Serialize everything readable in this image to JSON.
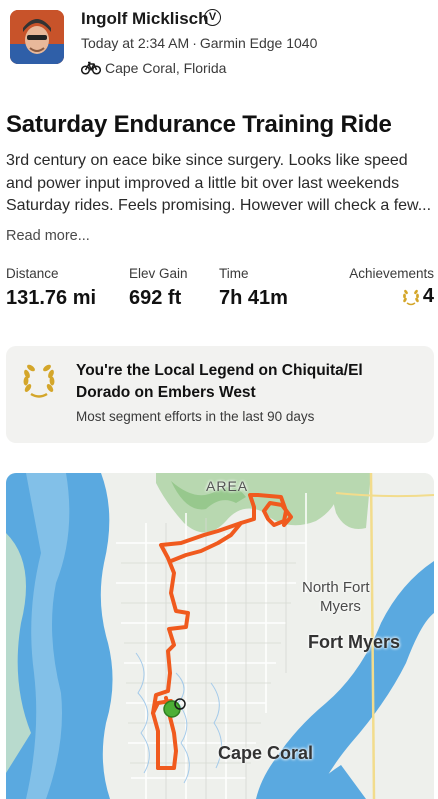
{
  "athlete": {
    "name": "Ingolf Micklisch",
    "verified_icon": "V",
    "time": "Today at 2:34 AM",
    "separator": "·",
    "device": "Garmin Edge 1040",
    "location": "Cape Coral, Florida"
  },
  "activity": {
    "title": "Saturday Endurance Training Ride",
    "description": "3rd century on eace bike since surgery. Looks like speed and power input  improved a little bit over last weekends Saturday rides. Feels promising. However will check a few...",
    "read_more": "Read more..."
  },
  "stats": [
    {
      "label": "Distance",
      "value": "131.76 mi"
    },
    {
      "label": "Elev Gain",
      "value": "692 ft"
    },
    {
      "label": "Time",
      "value": "7h 41m"
    },
    {
      "label": "Achievements",
      "value": "4"
    }
  ],
  "local_legend": {
    "title": "You're the Local Legend on Chiquita/El Dorado on Embers West",
    "subtitle": "Most segment efforts in the last 90 days"
  },
  "map": {
    "labels": {
      "area": "AREA",
      "north_fort_myers_1": "North Fort",
      "north_fort_myers_2": "Myers",
      "fort_myers": "Fort Myers",
      "cape_coral": "Cape Coral"
    },
    "colors": {
      "route": "#f05a1e",
      "water": "#5aa9e0",
      "land": "#eef0ec",
      "park": "#b8d8b0",
      "start_marker": "#4caf35"
    }
  },
  "icons": {
    "bike": "bicycle-icon",
    "laurel": "laurel-wreath-icon",
    "verified": "verified-badge-icon"
  }
}
